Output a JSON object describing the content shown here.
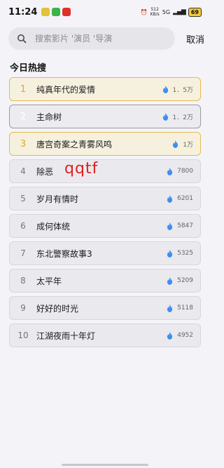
{
  "status_bar": {
    "time": "11:24",
    "net_speed": "512",
    "net_unit": "KB/s",
    "network_type": "5G",
    "battery": "69",
    "app_colors": [
      "#e1c23a",
      "#3bb54a",
      "#e1302a"
    ]
  },
  "search": {
    "placeholder": "搜索影片 '演员 '导演",
    "cancel_label": "取消"
  },
  "section_title": "今日热搜",
  "watermark": "qqtf",
  "accent_color": "#e8b84a",
  "flame_color": "#3f8ef0",
  "hot_list": [
    {
      "rank": "1",
      "title": "纯真年代的爱情",
      "score": "1．5万"
    },
    {
      "rank": "2",
      "title": "主命树",
      "score": "1．2万"
    },
    {
      "rank": "3",
      "title": "唐宫奇案之青雾风鸣",
      "score": "1万"
    },
    {
      "rank": "4",
      "title": "除恶",
      "score": "7800"
    },
    {
      "rank": "5",
      "title": "岁月有情时",
      "score": "6201"
    },
    {
      "rank": "6",
      "title": "成何体统",
      "score": "5847"
    },
    {
      "rank": "7",
      "title": "东北警察故事3",
      "score": "5325"
    },
    {
      "rank": "8",
      "title": "太平年",
      "score": "5209"
    },
    {
      "rank": "9",
      "title": "好好的时光",
      "score": "5118"
    },
    {
      "rank": "10",
      "title": "江湖夜雨十年灯",
      "score": "4952"
    }
  ]
}
